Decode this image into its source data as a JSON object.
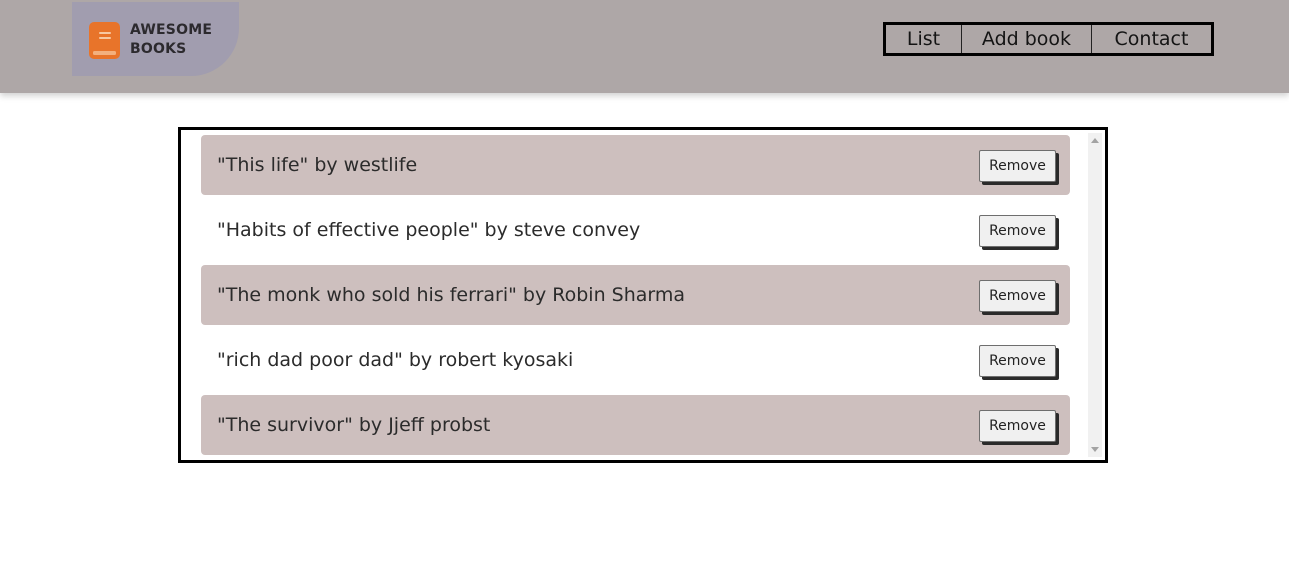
{
  "brand": {
    "line1": "AWESOME",
    "line2": "BOOKS",
    "icon": "book-icon",
    "icon_color": "#e8742a",
    "logo_bg": "#a19daf"
  },
  "nav": {
    "items": [
      {
        "label": "List"
      },
      {
        "label": "Add book"
      },
      {
        "label": "Contact"
      }
    ]
  },
  "books": [
    {
      "text": "\"This life\" by westlife",
      "button": "Remove"
    },
    {
      "text": "\"Habits of effective people\" by steve convey",
      "button": "Remove"
    },
    {
      "text": "\"The monk who sold his ferrari\" by Robin Sharma",
      "button": "Remove"
    },
    {
      "text": "\"rich dad poor dad\" by robert kyosaki",
      "button": "Remove"
    },
    {
      "text": "\"The survivor\" by Jjeff probst",
      "button": "Remove"
    }
  ],
  "colors": {
    "header_bg": "#aea7a7",
    "row_shaded": "#cdbfbe"
  }
}
